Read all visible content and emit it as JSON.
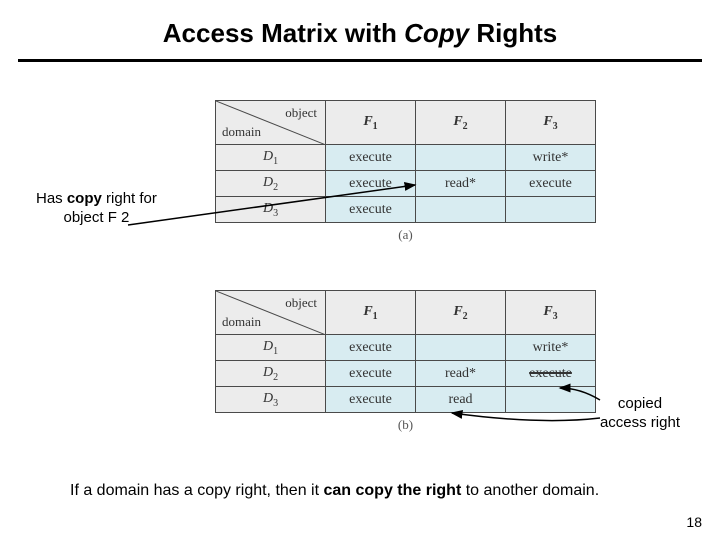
{
  "title": {
    "pre": "Access Matrix with ",
    "em": "Copy",
    "post": " Rights"
  },
  "labels": {
    "object": "object",
    "domain": "domain"
  },
  "columns": [
    "F",
    "F",
    "F"
  ],
  "col_sub": [
    "1",
    "2",
    "3"
  ],
  "domains": [
    "D",
    "D",
    "D"
  ],
  "dom_sub": [
    "1",
    "2",
    "3"
  ],
  "chart_data": [
    {
      "type": "table",
      "caption": "(a)",
      "rows": [
        [
          "execute",
          "",
          "write*"
        ],
        [
          "execute",
          "read*",
          "execute"
        ],
        [
          "execute",
          "",
          ""
        ]
      ]
    },
    {
      "type": "table",
      "caption": "(b)",
      "rows": [
        [
          "execute",
          "",
          "write*"
        ],
        [
          "execute",
          "read*",
          "execute"
        ],
        [
          "execute",
          "read",
          ""
        ]
      ],
      "strikethrough": {
        "row": 1,
        "col": 2,
        "text": "execute"
      }
    }
  ],
  "annot_left": {
    "l1a": "Has ",
    "l1b": "copy",
    "l1c": " right for",
    "l2": "object F 2"
  },
  "annot_right": {
    "l1": "copied",
    "l2": "access right"
  },
  "bottom": {
    "a": "If a domain has a copy right, then it ",
    "b": "can copy the right",
    "c": " to another  domain."
  },
  "pagenum": "18"
}
